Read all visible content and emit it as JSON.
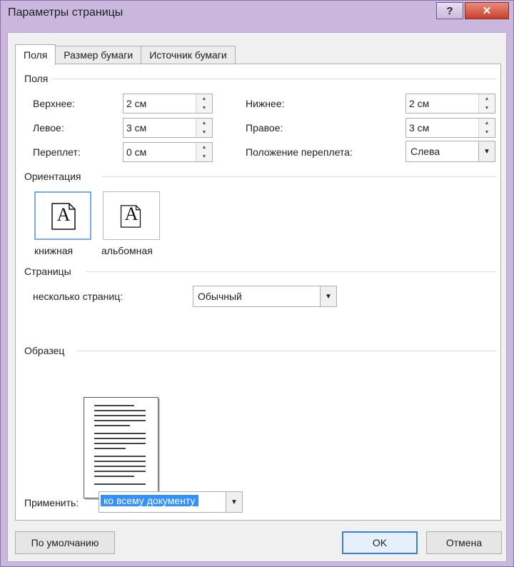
{
  "window": {
    "title": "Параметры страницы",
    "help_label": "?",
    "close_label": "✕"
  },
  "tabs": [
    {
      "label": "Поля"
    },
    {
      "label": "Размер бумаги"
    },
    {
      "label": "Источник бумаги"
    }
  ],
  "margins": {
    "section_label": "Поля",
    "top": {
      "label": "Верхнее:",
      "value": "2 см"
    },
    "bottom": {
      "label": "Нижнее:",
      "value": "2 см"
    },
    "left": {
      "label": "Левое:",
      "value": "3 см"
    },
    "right": {
      "label": "Правое:",
      "value": "3 см"
    },
    "gutter": {
      "label": "Переплет:",
      "value": "0 см"
    },
    "gutter_position": {
      "label": "Положение переплета:",
      "value": "Слева"
    }
  },
  "orientation": {
    "section_label": "Ориентация",
    "portrait": {
      "label": "книжная",
      "glyph": "A",
      "selected": true
    },
    "landscape": {
      "label": "альбомная",
      "glyph": "A",
      "selected": false
    }
  },
  "pages": {
    "section_label": "Страницы",
    "multiple_label": "несколько страниц:",
    "multiple_value": "Обычный"
  },
  "preview": {
    "section_label": "Образец"
  },
  "apply": {
    "label": "Применить:",
    "value": "ко всему документу"
  },
  "buttons": {
    "default_label": "По умолчанию",
    "ok_label": "OK",
    "cancel_label": "Отмена"
  },
  "icons": {
    "spin_up": "spin-up-arrow-icon",
    "spin_down": "spin-down-arrow-icon",
    "dropdown": "dropdown-arrow-icon"
  }
}
